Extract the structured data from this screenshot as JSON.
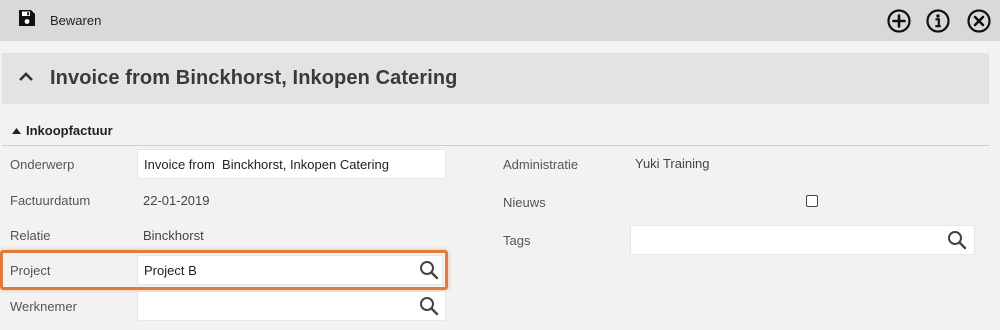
{
  "toolbar": {
    "save_label": "Bewaren",
    "icons": [
      "save-icon",
      "add-circle-icon",
      "info-circle-icon",
      "close-circle-icon"
    ]
  },
  "title": {
    "text": "Invoice from Binckhorst, Inkopen Catering",
    "icon": "chevron-up-icon"
  },
  "section": {
    "label": "Inkoopfactuur"
  },
  "left_fields": {
    "onderwerp": {
      "label": "Onderwerp",
      "value": "Invoice from  Binckhorst, Inkopen Catering"
    },
    "factuurdatum": {
      "label": "Factuurdatum",
      "value": "22-01-2019"
    },
    "relatie": {
      "label": "Relatie",
      "value": "Binckhorst"
    },
    "project": {
      "label": "Project",
      "value": "Project B"
    },
    "werknemer": {
      "label": "Werknemer",
      "value": ""
    }
  },
  "right_fields": {
    "administratie": {
      "label": "Administratie",
      "value": "Yuki Training"
    },
    "nieuws": {
      "label": "Nieuws",
      "checked": false
    },
    "tags": {
      "label": "Tags",
      "value": ""
    }
  },
  "colors": {
    "highlight": "#e07b39",
    "toolbar_bg": "#d9d9d9",
    "title_bg": "#e3e3e3",
    "page_bg": "#f2f2f2"
  }
}
